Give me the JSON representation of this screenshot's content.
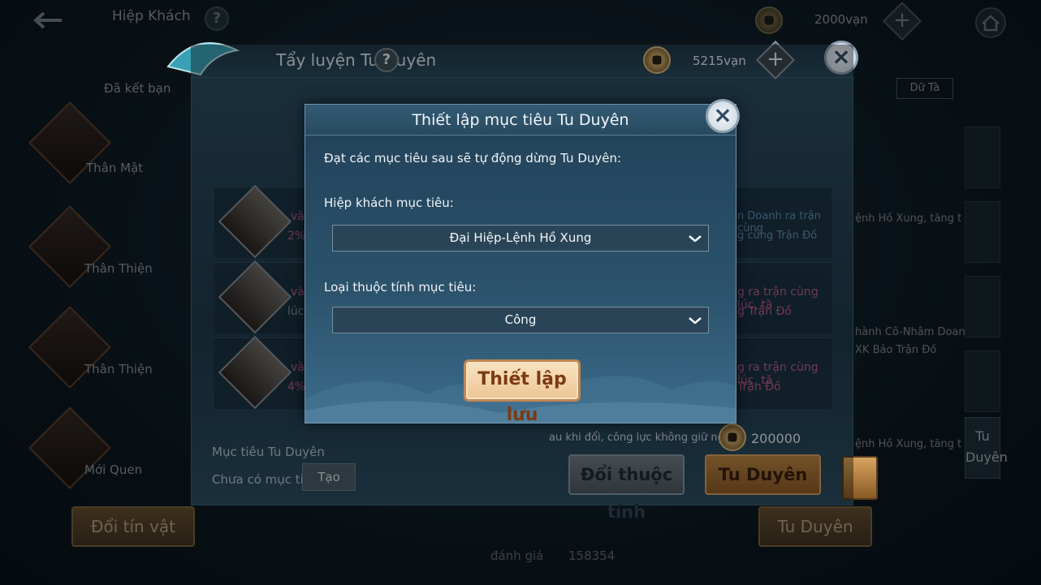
{
  "topbar": {
    "title": "Hiệp Khách",
    "currency": "2000vạn"
  },
  "left_panel": {
    "header": "Đã kết bạn",
    "names": [
      "Thân Mật",
      "Thân Thiện",
      "Thân Thiện",
      "Mới Quen"
    ],
    "button": "Đổi tín vật"
  },
  "right_panel": {
    "side_tab": "Tu Duyên",
    "button": "Tu Duyên",
    "desc_1": "ệnh Hồ Xung, tăng t",
    "desc_2": "hành Cô-Nhâm Doan",
    "desc_3": "XK Bảo Trận Đồ",
    "desc_4": "ệnh Hồ Xung, tăng t",
    "tab_label": "Dữ Tà"
  },
  "bottom_bar": {
    "label": "đánh giá",
    "value": "158354"
  },
  "panel": {
    "title": "Tẩy luyện Tu Duyên",
    "currency": "5215vạn",
    "rows": [
      {
        "left_line1": "và",
        "left_line2": "2%",
        "right_line1": "n Doanh ra trận cùng",
        "right_line2": "g cùng Trận Đồ"
      },
      {
        "left_line1": "và",
        "left_line2": "lúc,",
        "right_line1": "g ra trận cùng lúc, tă",
        "right_line2": "g Trận Đồ"
      },
      {
        "left_line1": "và",
        "left_line2": "4%",
        "right_line1": "g ra trận cùng lúc, tă",
        "right_line2": "Trận Đồ"
      }
    ],
    "warning": "au khi đổi, công lực không giữ nguyê",
    "cost": "200000",
    "target_label": "Mục tiêu Tu Duyên",
    "no_target": "Chưa có mục tiêu",
    "create_button": "Tạo",
    "change_button": "Đổi thuộc tính",
    "tu_duyen_button": "Tu Duyên"
  },
  "dialog": {
    "title": "Thiết lập mục tiêu Tu Duyên",
    "intro": "Đạt các mục tiêu sau sẽ tự động dừng Tu Duyên:",
    "hero_label": "Hiệp khách mục tiêu:",
    "hero_value": "Đại Hiệp-Lệnh Hồ Xung",
    "attr_label": "Loại thuộc tính mục tiêu:",
    "attr_value": "Công",
    "save_button": "Thiết lập lưu"
  },
  "colors": {
    "dialog_bg": "#2c536d",
    "save_button": "#ecc595",
    "accent_pink": "#b85c8a",
    "accent_blue": "#5f8fb0"
  },
  "icons": [
    "back-arrow-icon",
    "help-icon",
    "coin-icon",
    "plus-icon",
    "home-icon",
    "close-icon",
    "chevron-down-icon",
    "lantern-icon"
  ]
}
